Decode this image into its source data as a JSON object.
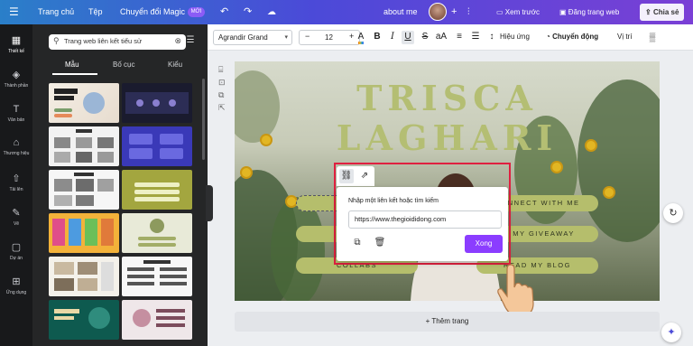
{
  "topbar": {
    "menu_icon": "menu-icon",
    "home": "Trang chủ",
    "file": "Tệp",
    "magic_switch": "Chuyển đổi Magic",
    "new_badge": "MỚI",
    "doc_title": "about me",
    "preview": "Xem trước",
    "publish": "Đăng trang web",
    "share": "Chia sẻ"
  },
  "leftnav": {
    "items": [
      {
        "label": "Thiết kế",
        "icon": "layout-icon"
      },
      {
        "label": "Thành phần",
        "icon": "shapes-icon"
      },
      {
        "label": "Văn bản",
        "icon": "text-icon"
      },
      {
        "label": "Thương hiệu",
        "icon": "brand-icon"
      },
      {
        "label": "Tải lên",
        "icon": "upload-icon"
      },
      {
        "label": "Vẽ",
        "icon": "draw-icon"
      },
      {
        "label": "Dự án",
        "icon": "folder-icon"
      },
      {
        "label": "Ứng dụng",
        "icon": "apps-icon"
      }
    ]
  },
  "panel": {
    "search_value": "Trang web liên kết tiểu sử",
    "tabs": [
      "Mẫu",
      "Bố cục",
      "Kiểu"
    ]
  },
  "toolbar": {
    "font": "Agrandir Grand",
    "minus": "−",
    "size": "12",
    "plus": "+",
    "effects": "Hiệu ứng",
    "animate": "Chuyển động",
    "position": "Vị trí"
  },
  "canvas": {
    "title_line1": "TRISCA",
    "title_line2": "LAGHARI",
    "buttons": [
      "CONNECT WITH ME",
      "IN MY GIVEAWAY",
      "COLLABS",
      "READ MY BLOG"
    ]
  },
  "link_popup": {
    "label": "Nhập một liên kết hoặc tìm kiếm",
    "url": "https://www.thegioididong.com",
    "done": "Xong"
  },
  "add_page": "+ Thêm trang",
  "colors": {
    "accent": "#8b3dff",
    "highlight_border": "#e02040",
    "olive_button": "#b5be6c",
    "title_green": "#b4be73"
  }
}
